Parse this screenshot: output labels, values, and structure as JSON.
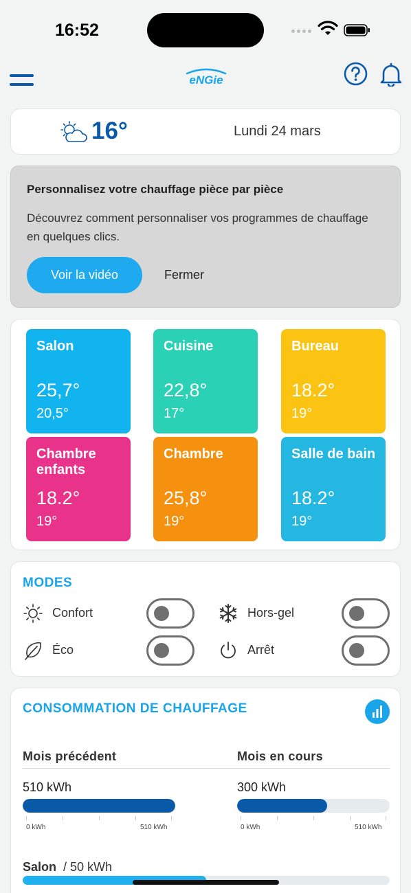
{
  "status": {
    "time": "16:52"
  },
  "header": {
    "logo_text": "ENGIE"
  },
  "weather": {
    "temperature": "16°",
    "date": "Lundi 24 mars"
  },
  "promo": {
    "title": "Personnalisez votre chauffage pièce par pièce",
    "text": "Découvrez comment personnaliser vos programmes de chauffage en quelques clics.",
    "video_button": "Voir la vidéo",
    "close_button": "Fermer"
  },
  "rooms": [
    {
      "name": "Salon",
      "temp": "25,7°",
      "setpoint": "20,5°",
      "color": "#12b4f0"
    },
    {
      "name": "Cuisine",
      "temp": "22,8°",
      "setpoint": "17°",
      "color": "#2bd1b5"
    },
    {
      "name": "Bureau",
      "temp": "18.2°",
      "setpoint": "19°",
      "color": "#fbc312"
    },
    {
      "name": "Chambre enfants",
      "temp": "18.2°",
      "setpoint": "19°",
      "color": "#e9338b"
    },
    {
      "name": "Chambre",
      "temp": "25,8°",
      "setpoint": "19°",
      "color": "#f5910f"
    },
    {
      "name": "Salle de bain",
      "temp": "18.2°",
      "setpoint": "19°",
      "color": "#23b7e2"
    }
  ],
  "modes": {
    "title": "MODES",
    "items": [
      {
        "label": "Confort",
        "icon": "sun-icon",
        "on": false
      },
      {
        "label": "Hors-gel",
        "icon": "snowflake-icon",
        "on": false
      },
      {
        "label": "Éco",
        "icon": "leaf-icon",
        "on": false
      },
      {
        "label": "Arrêt",
        "icon": "power-icon",
        "on": false
      }
    ]
  },
  "consumption": {
    "title": "CONSOMMATION DE CHAUFFAGE",
    "previous": {
      "label": "Mois précédent",
      "value": "510 kWh",
      "fraction": 1.0,
      "scale_min": "0 kWh",
      "scale_max": "510 kWh"
    },
    "current": {
      "label": "Mois en cours",
      "value": "300 kWh",
      "fraction": 0.59,
      "scale_min": "0 kWh",
      "scale_max": "510 kWh"
    },
    "room": {
      "name": "Salon",
      "value": "/ 50 kWh",
      "fraction": 0.5
    }
  },
  "colors": {
    "brand_blue": "#0b5aa9",
    "accent": "#1aa4e9"
  }
}
